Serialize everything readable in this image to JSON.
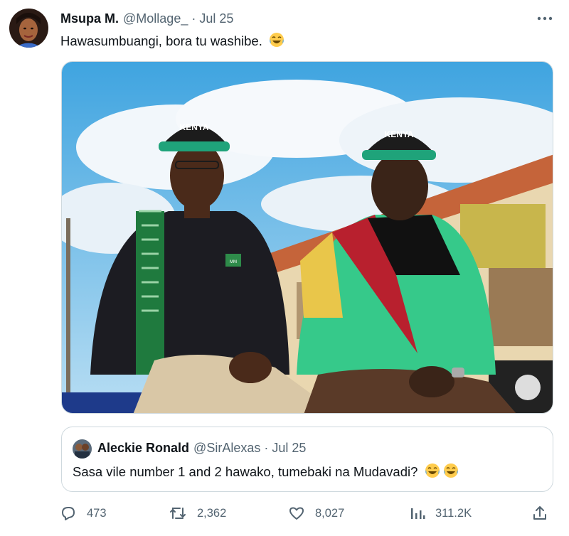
{
  "tweet": {
    "author": {
      "name": "Msupa M.",
      "handle": "@Mollage_",
      "separator": "·",
      "date": "Jul 25"
    },
    "text": "Hawasumbuangi, bora tu washibe.",
    "emoji": "face-with-tears-of-joy"
  },
  "quoted_tweet": {
    "author": {
      "name": "Aleckie Ronald",
      "handle": "@SirAlexas",
      "separator": "·",
      "date": "Jul 25"
    },
    "text": "Sasa vile number 1 and 2 hawako, tumebaki na Mudavadi?",
    "emoji": [
      "face-with-tears-of-joy",
      "face-with-tears-of-joy"
    ]
  },
  "media": {
    "cap_text": "KENYA",
    "shirt_text": "MM"
  },
  "actions": {
    "replies": "473",
    "retweets": "2,362",
    "likes": "8,027",
    "views": "311.2K"
  },
  "colors": {
    "text_primary": "#0f1419",
    "text_secondary": "#536471",
    "border": "#cfd9de"
  }
}
